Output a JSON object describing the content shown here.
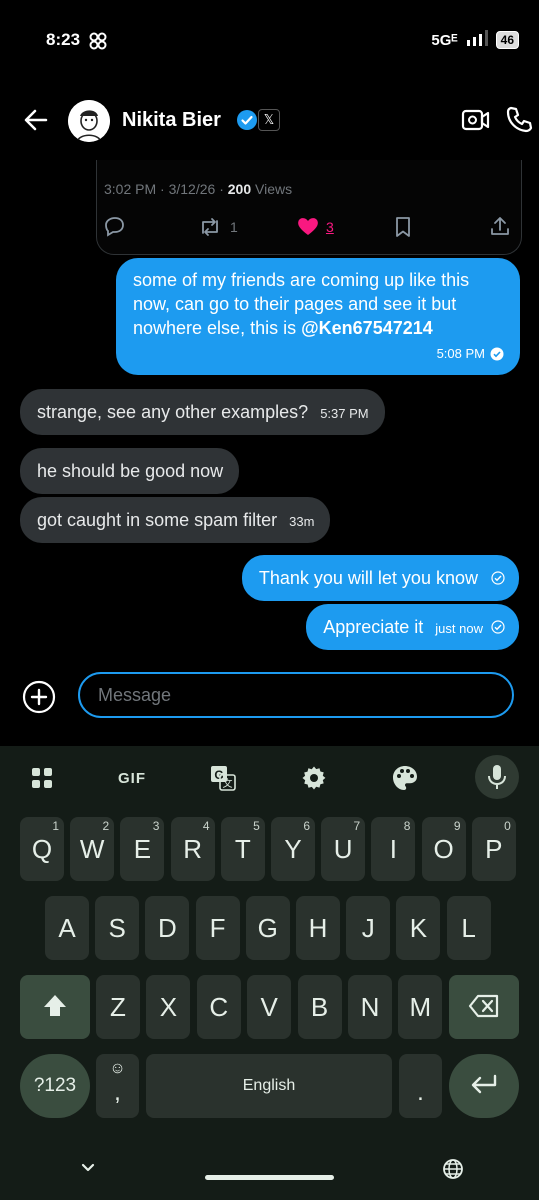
{
  "status_bar": {
    "time": "8:23",
    "network": "5Gᴱ",
    "battery": "46"
  },
  "header": {
    "name": "Nikita Bier",
    "x_badge": "𝕏"
  },
  "tweet": {
    "time": "3:02 PM",
    "date": "3/12/26",
    "views_count": "200",
    "views_label": "Views",
    "retweets": "1",
    "likes": "3"
  },
  "messages": [
    {
      "dir": "out",
      "text": "some of my friends are coming up like this now, can go to their pages and see it but nowhere else, this is",
      "mention": "@Ken67547214",
      "time": "5:08 PM"
    },
    {
      "dir": "in",
      "text": "strange, see any other examples?",
      "time": "5:37 PM"
    },
    {
      "dir": "in",
      "text": "he should be good now",
      "time": ""
    },
    {
      "dir": "in",
      "text": "got caught in some spam filter",
      "time": "33m"
    },
    {
      "dir": "out",
      "text": "Thank you will let you know",
      "time": ""
    },
    {
      "dir": "out",
      "text": "Appreciate it",
      "time": "just now"
    }
  ],
  "composer": {
    "placeholder": "Message"
  },
  "keyboard": {
    "toolbar": [
      "apps-icon",
      "gif",
      "translate-icon",
      "settings-icon",
      "palette-icon",
      "mic-icon"
    ],
    "gif_label": "GIF",
    "row1": [
      [
        "Q",
        "1"
      ],
      [
        "W",
        "2"
      ],
      [
        "E",
        "3"
      ],
      [
        "R",
        "4"
      ],
      [
        "T",
        "5"
      ],
      [
        "Y",
        "6"
      ],
      [
        "U",
        "7"
      ],
      [
        "I",
        "8"
      ],
      [
        "O",
        "9"
      ],
      [
        "P",
        "0"
      ]
    ],
    "row2": [
      "A",
      "S",
      "D",
      "F",
      "G",
      "H",
      "J",
      "K",
      "L"
    ],
    "row3": [
      "Z",
      "X",
      "C",
      "V",
      "B",
      "N",
      "M"
    ],
    "symbols_label": "?123",
    "emoji_key": "☺",
    "comma": ",",
    "space_label": "English",
    "period": "."
  },
  "colors": {
    "accent": "#1d9bf0",
    "like": "#f91880",
    "keyboard_bg": "#141c17",
    "key_bg": "#2a322d"
  }
}
